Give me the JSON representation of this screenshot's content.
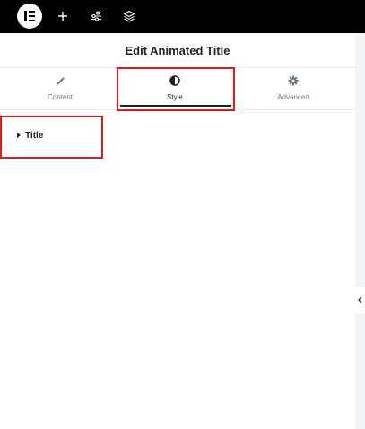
{
  "topbar": {
    "logo": "elementor-logo",
    "add_icon": "plus-icon",
    "settings_icon": "sliders-icon",
    "structure_icon": "layers-icon"
  },
  "panel": {
    "title": "Edit Animated Title"
  },
  "tabs": [
    {
      "label": "Content",
      "icon": "pencil-icon"
    },
    {
      "label": "Style",
      "icon": "half-circle-icon"
    },
    {
      "label": "Advanced",
      "icon": "gear-icon"
    }
  ],
  "active_tab": "Style",
  "sections": [
    {
      "label": "Title",
      "expanded": false
    }
  ],
  "colors": {
    "topbar_bg": "#000000",
    "highlight": "#e01b1b",
    "text_dark": "#1f2124",
    "text_muted": "#6d7882"
  }
}
